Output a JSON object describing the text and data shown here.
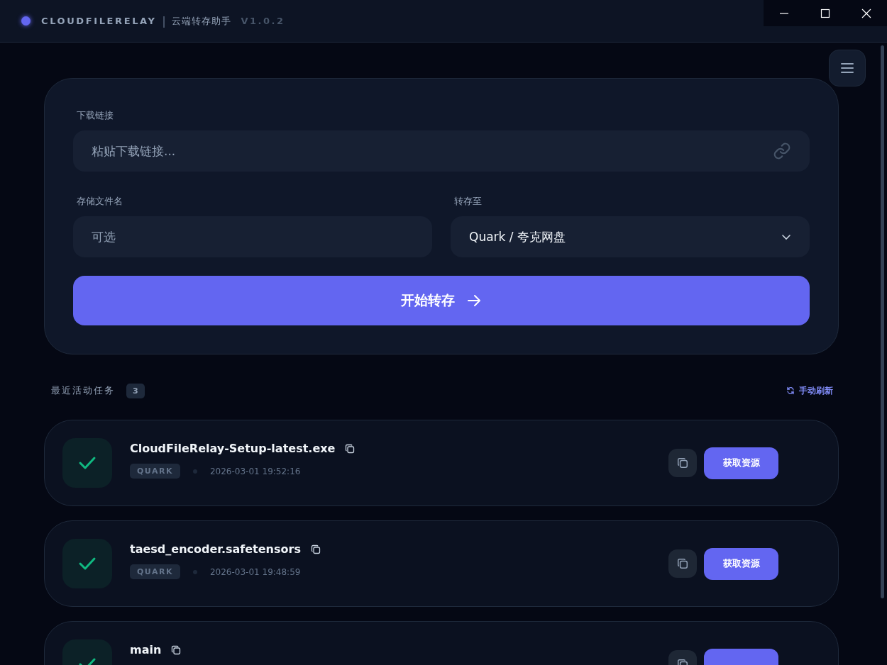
{
  "window": {
    "app_name": "CLOUDFILERELAY",
    "separator": "|",
    "subtitle": "云端转存助手",
    "version": "V1.0.2"
  },
  "form": {
    "link_label": "下载链接",
    "link_placeholder": "粘贴下载链接...",
    "filename_label": "存储文件名",
    "filename_placeholder": "可选",
    "target_label": "转存至",
    "target_value": "Quark / 夸克网盘",
    "submit": "开始转存"
  },
  "tasks_header": {
    "title": "最近活动任务",
    "count": "3",
    "refresh": "手动刷新"
  },
  "tasks": [
    {
      "name": "CloudFileRelay-Setup-latest.exe",
      "succeeded": true,
      "tag": "QUARK",
      "time": "2026-03-01 19:52:16",
      "action": "获取资源"
    },
    {
      "name": "taesd_encoder.safetensors",
      "succeeded": true,
      "tag": "QUARK",
      "time": "2026-03-01 19:48:59",
      "action": "获取资源"
    },
    {
      "name": "main",
      "succeeded": true
    }
  ]
}
